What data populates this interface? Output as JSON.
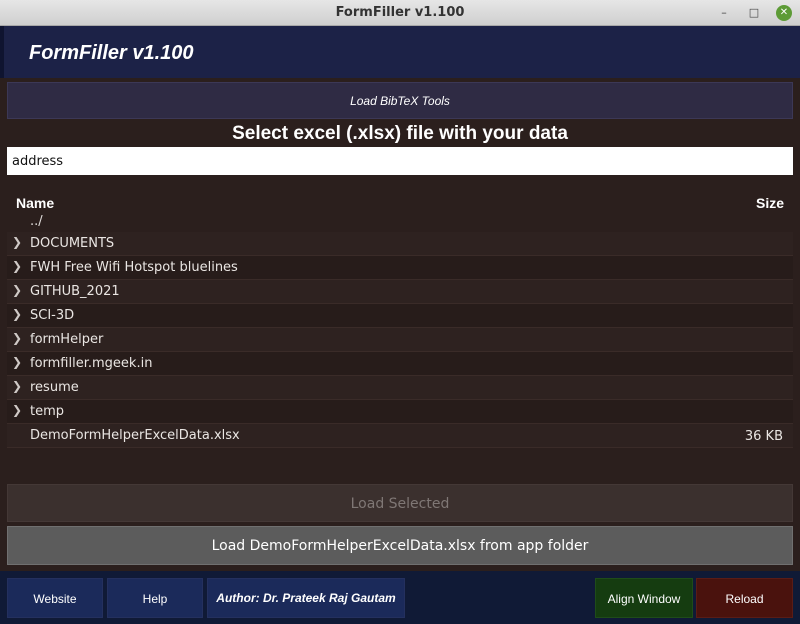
{
  "window": {
    "title": "FormFiller v1.100",
    "controls": {
      "minimize": "–",
      "maximize": "□",
      "close": "✕"
    }
  },
  "header": {
    "app_title": "FormFiller v1.100"
  },
  "bibtex_button": "Load BibTeX Tools",
  "heading": "Select excel (.xlsx) file with your data",
  "path_input": {
    "value": "address"
  },
  "file_list": {
    "columns": {
      "name": "Name",
      "size": "Size"
    },
    "parent": "../",
    "items": [
      {
        "name": "DOCUMENTS",
        "type": "folder",
        "size": ""
      },
      {
        "name": "FWH Free Wifi Hotspot bluelines",
        "type": "folder",
        "size": ""
      },
      {
        "name": "GITHUB_2021",
        "type": "folder",
        "size": ""
      },
      {
        "name": "SCI-3D",
        "type": "folder",
        "size": ""
      },
      {
        "name": "formHelper",
        "type": "folder",
        "size": ""
      },
      {
        "name": "formfiller.mgeek.in",
        "type": "folder",
        "size": ""
      },
      {
        "name": "resume",
        "type": "folder",
        "size": ""
      },
      {
        "name": "temp",
        "type": "folder",
        "size": ""
      },
      {
        "name": "DemoFormHelperExcelData.xlsx",
        "type": "file",
        "size": "36 KB"
      }
    ]
  },
  "load_selected": {
    "label": "Load Selected",
    "enabled": false
  },
  "load_demo": "Load DemoFormHelperExcelData.xlsx from app folder",
  "footer": {
    "website": "Website",
    "help": "Help",
    "author": "Author: Dr. Prateek Raj Gautam",
    "align_window": "Align Window",
    "reload": "Reload"
  },
  "colors": {
    "header_bg": "#1c2247",
    "body_bg": "#2b1f1d",
    "footer_bg": "#101a36",
    "align_button": "#153c10",
    "reload_button": "#4a120d",
    "close_button": "#5d9b36"
  }
}
